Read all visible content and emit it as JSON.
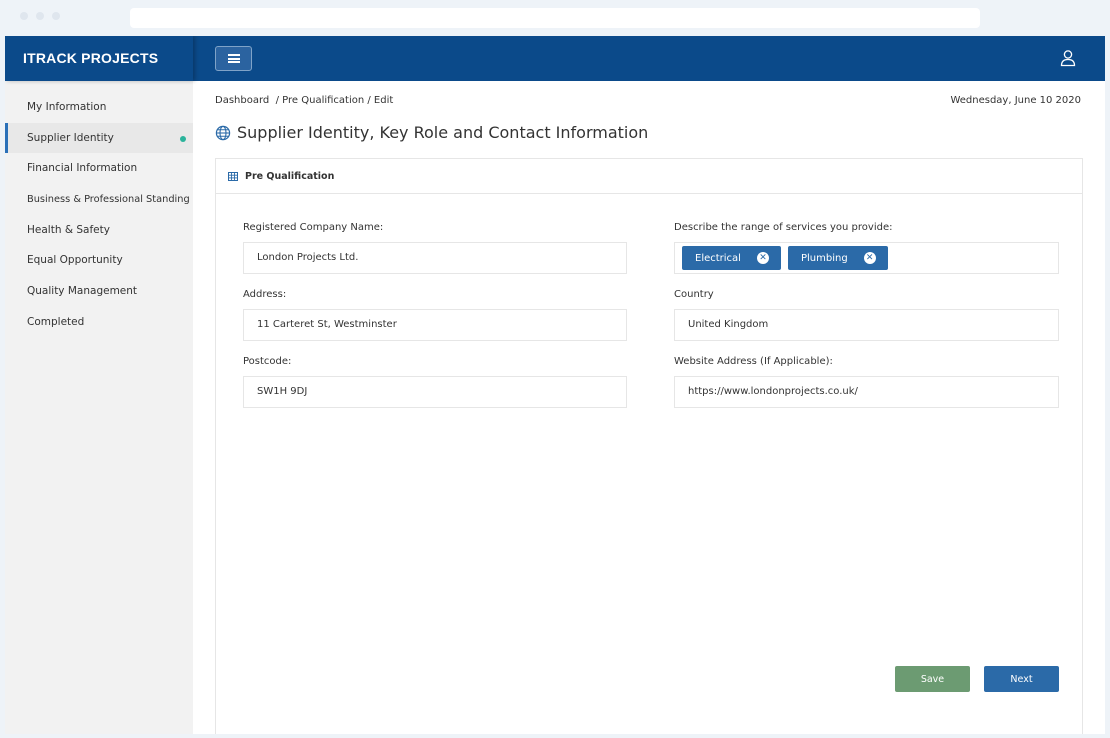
{
  "app": {
    "brand": "ITRACK PROJECTS"
  },
  "sidebar": {
    "items": [
      {
        "label": "My Information"
      },
      {
        "label": "Supplier Identity"
      },
      {
        "label": "Financial Information"
      },
      {
        "label": "Business & Professional Standing"
      },
      {
        "label": "Health & Safety"
      },
      {
        "label": "Equal Opportunity"
      },
      {
        "label": "Quality Management"
      },
      {
        "label": "Completed"
      }
    ]
  },
  "header": {
    "breadcrumb": "Dashboard  / Pre Qualification / Edit",
    "date": "Wednesday, June 10 2020",
    "title": "Supplier Identity, Key Role and Contact Information"
  },
  "card": {
    "title": "Pre Qualification"
  },
  "form": {
    "company_name": {
      "label": "Registered Company Name:",
      "value": "London Projects Ltd."
    },
    "services": {
      "label": "Describe the range of services you provide:",
      "tags": [
        "Electrical",
        "Plumbing"
      ]
    },
    "address": {
      "label": "Address:",
      "value": "11 Carteret St, Westminster"
    },
    "country": {
      "label": "Country",
      "value": "United Kingdom"
    },
    "postcode": {
      "label": "Postcode:",
      "value": "SW1H 9DJ"
    },
    "website": {
      "label": "Website Address (If Applicable):",
      "value": "https://www.londonprojects.co.uk/"
    }
  },
  "actions": {
    "save_label": "Save",
    "next_label": "Next"
  },
  "colors": {
    "brand": "#0b4a8a",
    "accent": "#2b6aa8",
    "save": "#6c9b72",
    "status_dot": "#2bb39b"
  },
  "icons": {
    "menu": "hamburger-icon",
    "user": "user-icon",
    "globe": "globe-icon",
    "table": "table-icon",
    "tag_remove": "close-circle-icon"
  }
}
